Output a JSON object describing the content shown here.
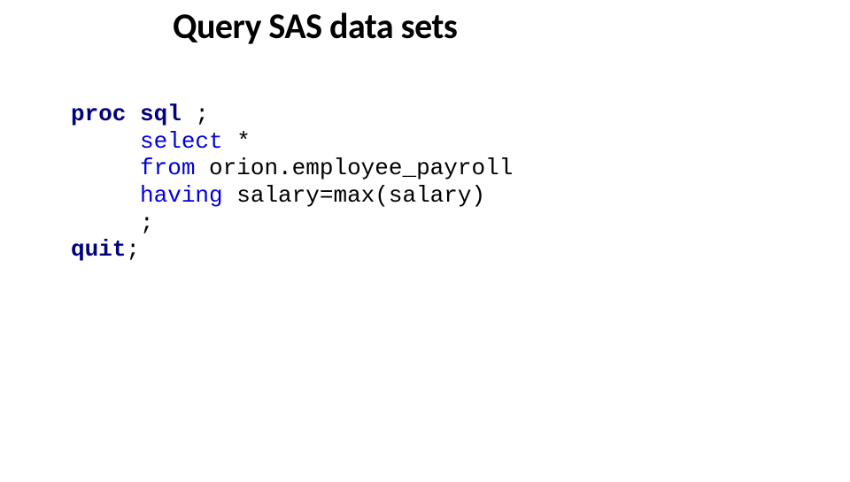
{
  "title": "Query SAS data sets",
  "code": {
    "line1": {
      "kw": "proc sql",
      "rest": " ;"
    },
    "line2": {
      "indent": "     ",
      "stmt": "select",
      "rest": " *"
    },
    "line3": {
      "indent": "     ",
      "stmt": "from",
      "rest": " orion.employee_payroll"
    },
    "line4": {
      "indent": "     ",
      "stmt": "having",
      "rest": " salary=max(salary)"
    },
    "line5": {
      "indent": "     ",
      "rest": ";"
    },
    "line6": {
      "kw": "quit",
      "rest": ";"
    }
  }
}
